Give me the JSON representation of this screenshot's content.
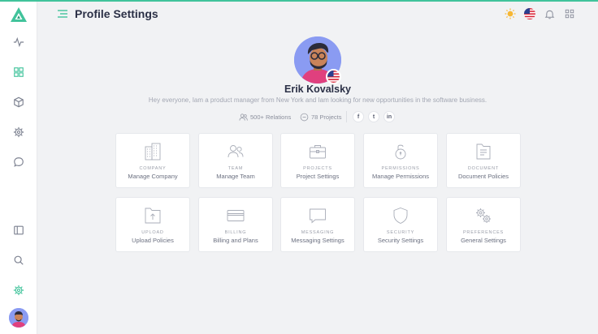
{
  "header": {
    "title": "Profile Settings"
  },
  "profile": {
    "name": "Erik Kovalsky",
    "bio": "Hey everyone,  Iam a product manager from New York and Iam looking for new opportunities in the software business.",
    "relations": "500+ Relations",
    "projects": "78 Projects",
    "social": [
      "f",
      "t",
      "in"
    ]
  },
  "cards": [
    {
      "kicker": "COMPANY",
      "label": "Manage Company",
      "icon": "building-icon"
    },
    {
      "kicker": "TEAM",
      "label": "Manage Team",
      "icon": "team-icon"
    },
    {
      "kicker": "PROJECTS",
      "label": "Project Settings",
      "icon": "briefcase-icon"
    },
    {
      "kicker": "PERMISSIONS",
      "label": "Manage Permissions",
      "icon": "lock-icon"
    },
    {
      "kicker": "DOCUMENT",
      "label": "Document Policies",
      "icon": "document-icon"
    },
    {
      "kicker": "UPLOAD",
      "label": "Upload Policies",
      "icon": "upload-icon"
    },
    {
      "kicker": "BILLING",
      "label": "Billing and Plans",
      "icon": "credit-card-icon"
    },
    {
      "kicker": "MESSAGING",
      "label": "Messaging Settings",
      "icon": "chat-icon"
    },
    {
      "kicker": "SECURITY",
      "label": "Security Settings",
      "icon": "shield-icon"
    },
    {
      "kicker": "PREFERENCES",
      "label": "General Settings",
      "icon": "gears-icon"
    }
  ],
  "colors": {
    "accent": "#41c39b",
    "text_dark": "#2b3046",
    "text_muted": "#a3a7b3",
    "sun": "#f7b733"
  }
}
